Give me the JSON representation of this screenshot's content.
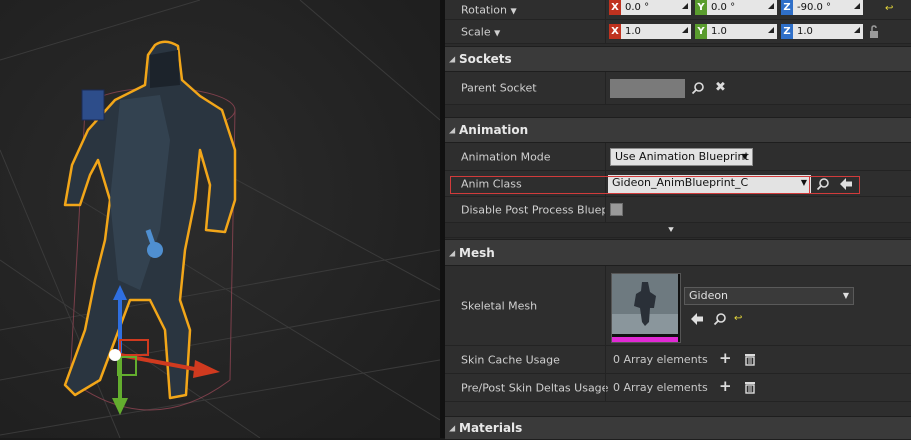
{
  "colors": {
    "accent": "#d13b3b",
    "x_axis": "#c0321f",
    "y_axis": "#5a9c2e",
    "z_axis": "#2f6fc8",
    "selection_outline": "#f2a619"
  },
  "transform": {
    "rotation": {
      "label": "Rotation",
      "x": "0.0 °",
      "y": "0.0 °",
      "z": "-90.0 °"
    },
    "scale": {
      "label": "Scale",
      "x": "1.0",
      "y": "1.0",
      "z": "1.0"
    },
    "axis_labels": {
      "x": "X",
      "y": "Y",
      "z": "Z"
    }
  },
  "sockets": {
    "title": "Sockets",
    "parent_socket_label": "Parent Socket",
    "parent_socket_value": ""
  },
  "animation": {
    "title": "Animation",
    "mode_label": "Animation Mode",
    "mode_value": "Use Animation Blueprint",
    "anim_class_label": "Anim Class",
    "anim_class_value": "Gideon_AnimBlueprint_C",
    "disable_pp_label": "Disable Post Process Blueprint",
    "disable_pp_checked": false
  },
  "mesh": {
    "title": "Mesh",
    "skeletal_mesh_label": "Skeletal Mesh",
    "skeletal_mesh_value": "Gideon",
    "skin_cache_label": "Skin Cache Usage",
    "skin_cache_value": "0 Array elements",
    "skin_deltas_label": "Pre/Post Skin Deltas Usage",
    "skin_deltas_value": "0 Array elements"
  },
  "materials": {
    "title": "Materials"
  },
  "icons": {
    "browse": "search-icon",
    "clear": "close-icon",
    "use_selected": "arrow-left-icon",
    "add": "plus-icon",
    "delete": "trash-icon",
    "reset": "reset-arrow-icon",
    "lock": "lock-icon"
  }
}
